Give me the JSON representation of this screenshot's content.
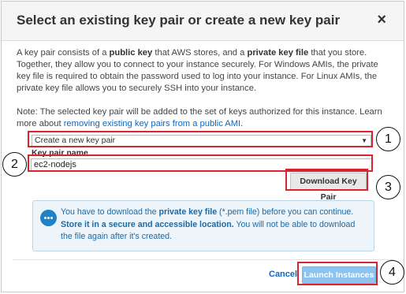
{
  "dialog": {
    "title": "Select an existing key pair or create a new key pair",
    "close_symbol": "×"
  },
  "intro": {
    "s1": "A key pair consists of a ",
    "b1": "public key",
    "s2": " that AWS stores, and a ",
    "b2": "private key file",
    "s3": " that you store. Together, they allow you to connect to your instance securely. For Windows AMIs, the private key file is required to obtain the password used to log into your instance. For Linux AMIs, the private key file allows you to securely SSH into your instance."
  },
  "note": {
    "text": "Note: The selected key pair will be added to the set of keys authorized for this instance. Learn more about ",
    "link": "removing existing key pairs from a public AMI",
    "end": "."
  },
  "form": {
    "select_value": "Create a new key pair",
    "key_pair_label": "Key pair name",
    "key_pair_value": "ec2-nodejs",
    "download_button": "Download Key Pair"
  },
  "info": {
    "icon": "chat-bubble-icon",
    "s1": "You have to download the ",
    "b1": "private key file",
    "s2": " (*.pem file) before you can continue. ",
    "b2": "Store it in a secure and accessible location.",
    "s3": " You will not be able to download the file again after it's created."
  },
  "footer": {
    "cancel": "Cancel",
    "launch": "Launch Instances"
  },
  "annotations": [
    "1",
    "2",
    "3",
    "4"
  ],
  "colors": {
    "highlight": "#d9232d",
    "link": "#1166bb",
    "info_background": "#edf4fa",
    "info_text": "#1d6aa5",
    "launch_button": "#8dc3ec"
  }
}
